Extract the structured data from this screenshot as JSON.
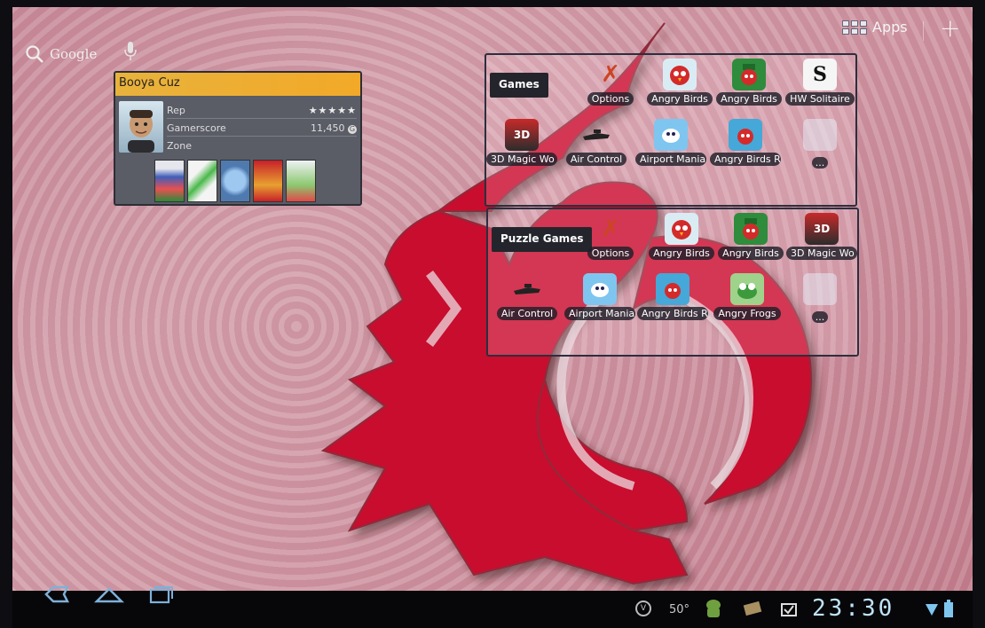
{
  "search": {
    "label": "Google",
    "icon": "search-icon"
  },
  "topbar": {
    "apps_label": "Apps"
  },
  "xbox_widget": {
    "gamertag": "Booya Cuz",
    "rows": [
      {
        "label": "Rep",
        "value": "★★★★★"
      },
      {
        "label": "Gamerscore",
        "value": "11,450"
      },
      {
        "label": "Zone",
        "value": ""
      }
    ]
  },
  "folders": [
    {
      "title": "Games",
      "apps": [
        {
          "label": "Options",
          "icon": "options-icon"
        },
        {
          "label": "Angry Birds",
          "icon": "angry-birds-icon"
        },
        {
          "label": "Angry Birds",
          "icon": "angry-birds-seasons-icon"
        },
        {
          "label": "HW Solitaire",
          "icon": "hw-solitaire-icon"
        },
        {
          "label": "3D Magic Wo",
          "icon": "3d-magic-words-icon"
        },
        {
          "label": "Air Control",
          "icon": "air-control-icon"
        },
        {
          "label": "Airport Mania",
          "icon": "airport-mania-icon"
        },
        {
          "label": "Angry Birds Ri",
          "icon": "angry-birds-rio-icon"
        }
      ],
      "more": "..."
    },
    {
      "title": "Puzzle Games",
      "apps": [
        {
          "label": "Options",
          "icon": "options-icon"
        },
        {
          "label": "Angry Birds",
          "icon": "angry-birds-icon"
        },
        {
          "label": "Angry Birds",
          "icon": "angry-birds-seasons-icon"
        },
        {
          "label": "3D Magic Wo",
          "icon": "3d-magic-words-icon"
        },
        {
          "label": "Air Control",
          "icon": "air-control-icon"
        },
        {
          "label": "Airport Mania",
          "icon": "airport-mania-icon"
        },
        {
          "label": "Angry Birds Ri",
          "icon": "angry-birds-rio-icon"
        },
        {
          "label": "Angry Frogs",
          "icon": "angry-frogs-icon"
        }
      ],
      "more": "..."
    }
  ],
  "statusbar": {
    "temperature": "50°",
    "time": "23:30"
  },
  "colors": {
    "wallpaper_pink": "#cf96a3",
    "cougar_red": "#c8102e",
    "xbox_header": "#f2a928",
    "clock_blue": "#bfe3f5"
  }
}
